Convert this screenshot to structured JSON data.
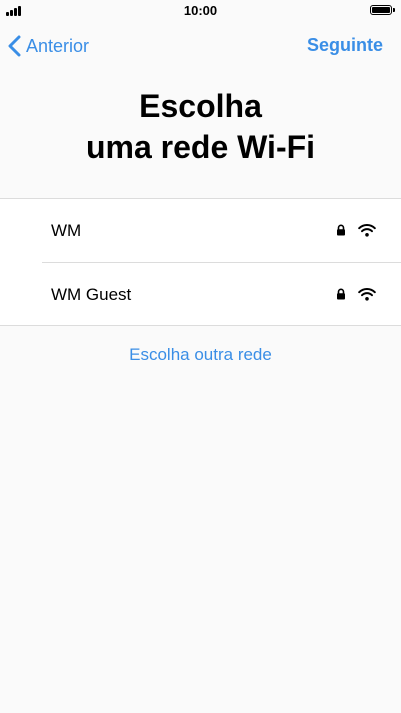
{
  "status_bar": {
    "time": "10:00",
    "icons": [
      "signal-icon",
      "battery-icon"
    ]
  },
  "nav": {
    "back_label": "Anterior",
    "next_label": "Seguinte",
    "back_icon": "chevron-left-icon"
  },
  "title": {
    "line1": "Escolha",
    "line2": "uma rede Wi-Fi"
  },
  "networks": [
    {
      "name": "WM",
      "locked": true,
      "icons": [
        "lock-icon",
        "wifi-icon"
      ]
    },
    {
      "name": "WM Guest",
      "locked": true,
      "icons": [
        "lock-icon",
        "wifi-icon"
      ]
    }
  ],
  "other_network_label": "Escolha outra rede",
  "colors": {
    "accent": "#3a8ee6",
    "background": "#fafafa",
    "list_background": "#ffffff",
    "divider": "#dcdcdc"
  }
}
